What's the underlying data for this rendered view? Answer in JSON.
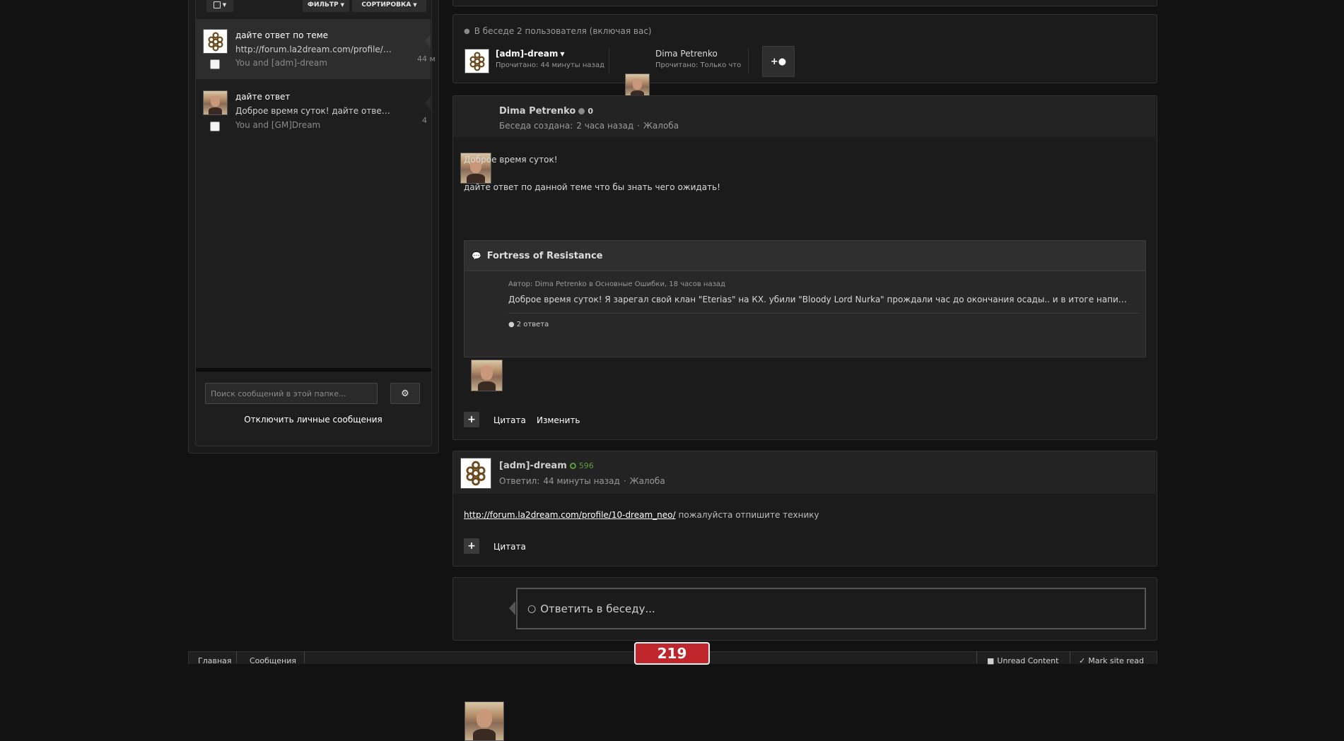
{
  "toolbar": {
    "select_icon": "checkbox-dropdown-icon",
    "filter_label": "ФИЛЬТР",
    "sort_label": "СОРТИРОВКА"
  },
  "conversations": [
    {
      "title": "дайте ответ по теме",
      "snippet": "http://forum.la2dream.com/profile/10-...",
      "participants": "You and [adm]-dream",
      "time": "44 м",
      "active": true
    },
    {
      "title": "дайте ответ",
      "snippet": "Доброе время суток! дайте ответ по...",
      "participants": "You and [GM]Dream",
      "time": "4",
      "active": false
    }
  ],
  "folder_search": {
    "placeholder": "Поиск сообщений в этой папке..."
  },
  "disable_pm_label": "Отключить личные сообщения",
  "participants_panel": {
    "heading": "В беседе 2 пользователя (включая вас)",
    "users": [
      {
        "name": "[adm]-dream",
        "read": "Прочитано: 44 минуты назад"
      },
      {
        "name": "Dima Petrenko",
        "read": "Прочитано: Только что"
      }
    ]
  },
  "post1": {
    "author": "Dima Petrenko",
    "rep": "0",
    "meta_prefix": "Беседа создана:",
    "time": "2 часа назад",
    "separator": "·",
    "report": "Жалоба",
    "paragraphs": [
      "Доброе время суток!",
      "дайте ответ по данной теме что бы знать чего ожидать!"
    ],
    "embed": {
      "title": "Fortress of Resistance",
      "author_line": "Автор: Dima Petrenko в Основные Ошибки, 18 часов назад",
      "text": "Доброе время суток! Я зарегал свой клан \"Eterias\" на КХ. убили \"Bloody Lord Nurka\"   прождали час до окончания осады.. и в итоге написало что...",
      "replies": "2 ответа"
    },
    "actions": {
      "plus": "+",
      "quote": "Цитата",
      "edit": "Изменить"
    }
  },
  "post2": {
    "author": "[adm]-dream",
    "rep": "596",
    "meta_prefix": "Ответил:",
    "time": "44 минуты назад",
    "separator": "·",
    "report": "Жалоба",
    "link": "http://forum.la2dream.com/profile/10-dream_neo/",
    "text": "пожалуйста отпишите технику",
    "actions": {
      "plus": "+",
      "quote": "Цитата"
    }
  },
  "reply": {
    "label": "Ответить в беседу..."
  },
  "footer": {
    "breadcrumbs": [
      "Главная",
      "Сообщения"
    ],
    "counter": "219",
    "unread": "Unread Content",
    "mark_read": "Mark site read"
  },
  "colors": {
    "background": "#121212",
    "panel": "#1b1b1b",
    "active_item": "#2d2d2d",
    "rep_positive": "#5a9e3a",
    "counter_red": "#c0272d"
  }
}
